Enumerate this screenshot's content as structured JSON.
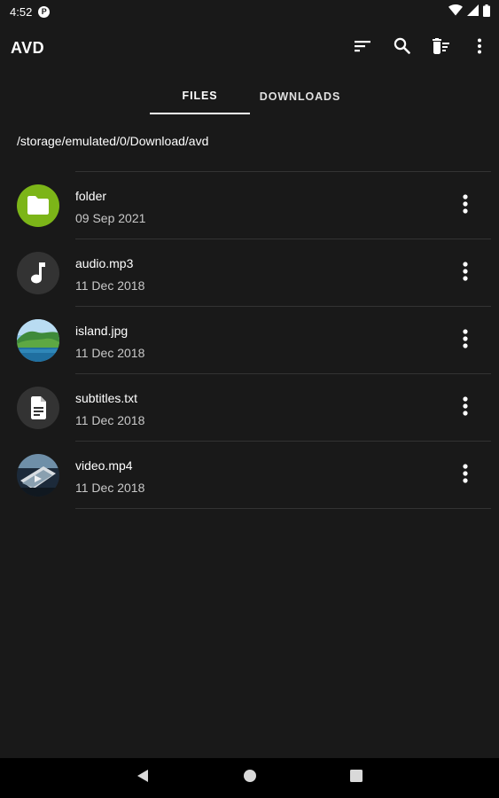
{
  "status_bar": {
    "time": "4:52",
    "badge": "P",
    "icons": [
      "wifi-icon",
      "signal-icon",
      "battery-icon"
    ]
  },
  "app_bar": {
    "title": "AVD",
    "actions": [
      "sort-icon",
      "search-icon",
      "delete-sweep-icon",
      "more-vert-icon"
    ]
  },
  "tabs": [
    {
      "label": "FILES",
      "active": true
    },
    {
      "label": "DOWNLOADS",
      "active": false
    }
  ],
  "path": "/storage/emulated/0/Download/avd",
  "files": [
    {
      "name": "folder",
      "date": "09 Sep 2021",
      "icon": "folder-icon",
      "icon_color": "#7cb518"
    },
    {
      "name": "audio.mp3",
      "date": "11 Dec 2018",
      "icon": "music-note-icon",
      "icon_color": "#333333"
    },
    {
      "name": "island.jpg",
      "date": "11 Dec 2018",
      "icon": "image-thumbnail",
      "icon_color": "#2b7a4b"
    },
    {
      "name": "subtitles.txt",
      "date": "11 Dec 2018",
      "icon": "document-icon",
      "icon_color": "#333333"
    },
    {
      "name": "video.mp4",
      "date": "11 Dec 2018",
      "icon": "video-thumbnail",
      "icon_color": "#4a6a8a"
    }
  ],
  "nav_bar": {
    "icons": [
      "back-icon",
      "home-icon",
      "recents-icon"
    ]
  },
  "colors": {
    "background": "#191919",
    "folder_accent": "#7cb518",
    "divider": "#333333"
  }
}
